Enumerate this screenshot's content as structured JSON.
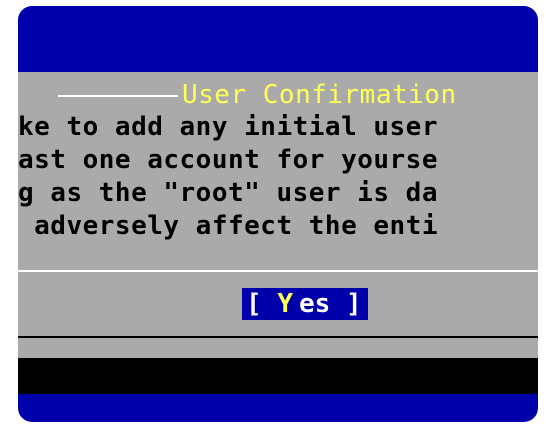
{
  "dialog": {
    "title": "User Confirmation",
    "message_lines": [
      "ke to add any initial user",
      "ast one account for yourse",
      "g as the \"root\" user is da",
      " adversely affect the enti"
    ]
  },
  "buttons": {
    "yes": {
      "open_bracket": "[",
      "hotkey": "Y",
      "rest": "es",
      "close_bracket": "]"
    }
  },
  "colors": {
    "background": "#0000aa",
    "dialog": "#aaaaaa",
    "title": "#ffff55",
    "text": "#000000",
    "button_bg": "#0000aa"
  }
}
